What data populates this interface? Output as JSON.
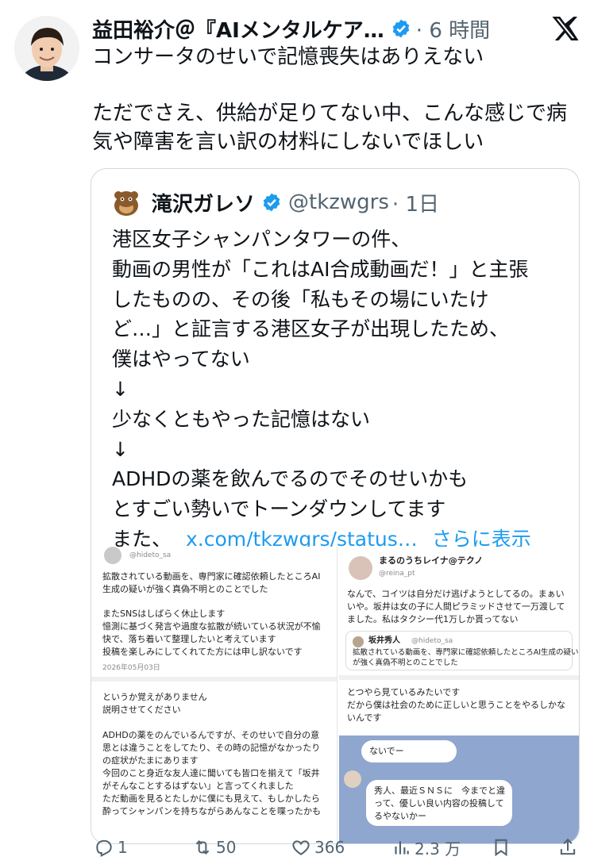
{
  "post": {
    "author_name": "益田裕介＠『AIメンタルケア…",
    "time": "· 6 時間",
    "lines": [
      "コンサータのせいで記憶喪失はありえない",
      "ただでさえ、供給が足りてない中、こんな感じで病",
      "気や障害を言い訳の材料にしないでほしい"
    ]
  },
  "quoted": {
    "name": "滝沢ガレソ",
    "handle": "@tkzwgrs",
    "time": "· 1日",
    "lines": [
      "港区女子シャンパンタワーの件、",
      "動画の男性が「これはAI合成動画だ！」と主張",
      "したものの、その後「私もその場にいたけ",
      "ど…」と証言する港区女子が出現したため、",
      "僕はやってない",
      "↓",
      "少なくともやった記憶はない",
      "↓",
      "ADHDの薬を飲んでるのでそのせいかも",
      "とすごい勢いでトーンダウンしてます"
    ],
    "last_line_prefix": "また、",
    "link_text": "x.com/tkzwgrs/status…",
    "show_more": "さらに表示"
  },
  "left_image": {
    "top_handle": "@hideto_sa",
    "lines_a": [
      "拡散されている動画を、専門家に確認依頼したところAI",
      "生成の疑いが強く真偽不明とのことでした",
      "",
      "またSNSはしばらく休止します",
      "憶測に基づく発言や過度な拡散が続いている状況が不愉",
      "快で、落ち着いて整理したいと考えています",
      "投稿を楽しみにしてくれてた方には申し訳ないです"
    ],
    "date": "2026年05月03日",
    "lines_b": [
      "というか覚えがありません",
      "説明させてください",
      "",
      "ADHDの薬をのんでいるんですが、そのせいで自分の意",
      "思とは違うことをしてたり、その時の記憶がなかったり",
      "の症状がたまにあります",
      "今回のこと身近な友人達に聞いても皆口を揃えて「坂井",
      "がそんなことするはずない」と言ってくれました",
      "ただ動画を見るとたしかに僕にも見えて、もしかしたら",
      "酔ってシャンパンを持ちながらあんなことを喋ったかも"
    ]
  },
  "right_image": {
    "name": "まるのうちレイナ@テクノ",
    "handle": "@reina_pt",
    "lines": [
      "なんで、コイツは自分だけ逃げようとしてるの。まぁい",
      "いや。坂井は女の子に人間ピラミッドさせて一万渡して",
      "ました。私はタクシー代1万しか貰ってない"
    ],
    "inner_name": "坂井秀人",
    "inner_handle": "@hideto_sa",
    "inner_lines": [
      "拡散されている動画を、専門家に確認依頼したところAI生成の疑い",
      "が強く真偽不明とのことでした"
    ],
    "lines_b": [
      "とつやら見ているみたいです",
      "だから僕は社会のために正しいと思うことをやるしかな",
      "いんです"
    ],
    "chat_top": "ないでー",
    "chat_lines": [
      "秀人、最近ＳＮＳに　今までと違",
      "って、優しい良い内容の投稿して",
      "るやないかー"
    ]
  },
  "actions": {
    "reply_count": "1",
    "repost_count": "50",
    "like_count": "366",
    "view_count": "2.3 万"
  },
  "colors": {
    "link": "#1d9bf0",
    "verified": "#1d9bf0",
    "secondary_text": "#536471",
    "border": "#cfd9de"
  }
}
